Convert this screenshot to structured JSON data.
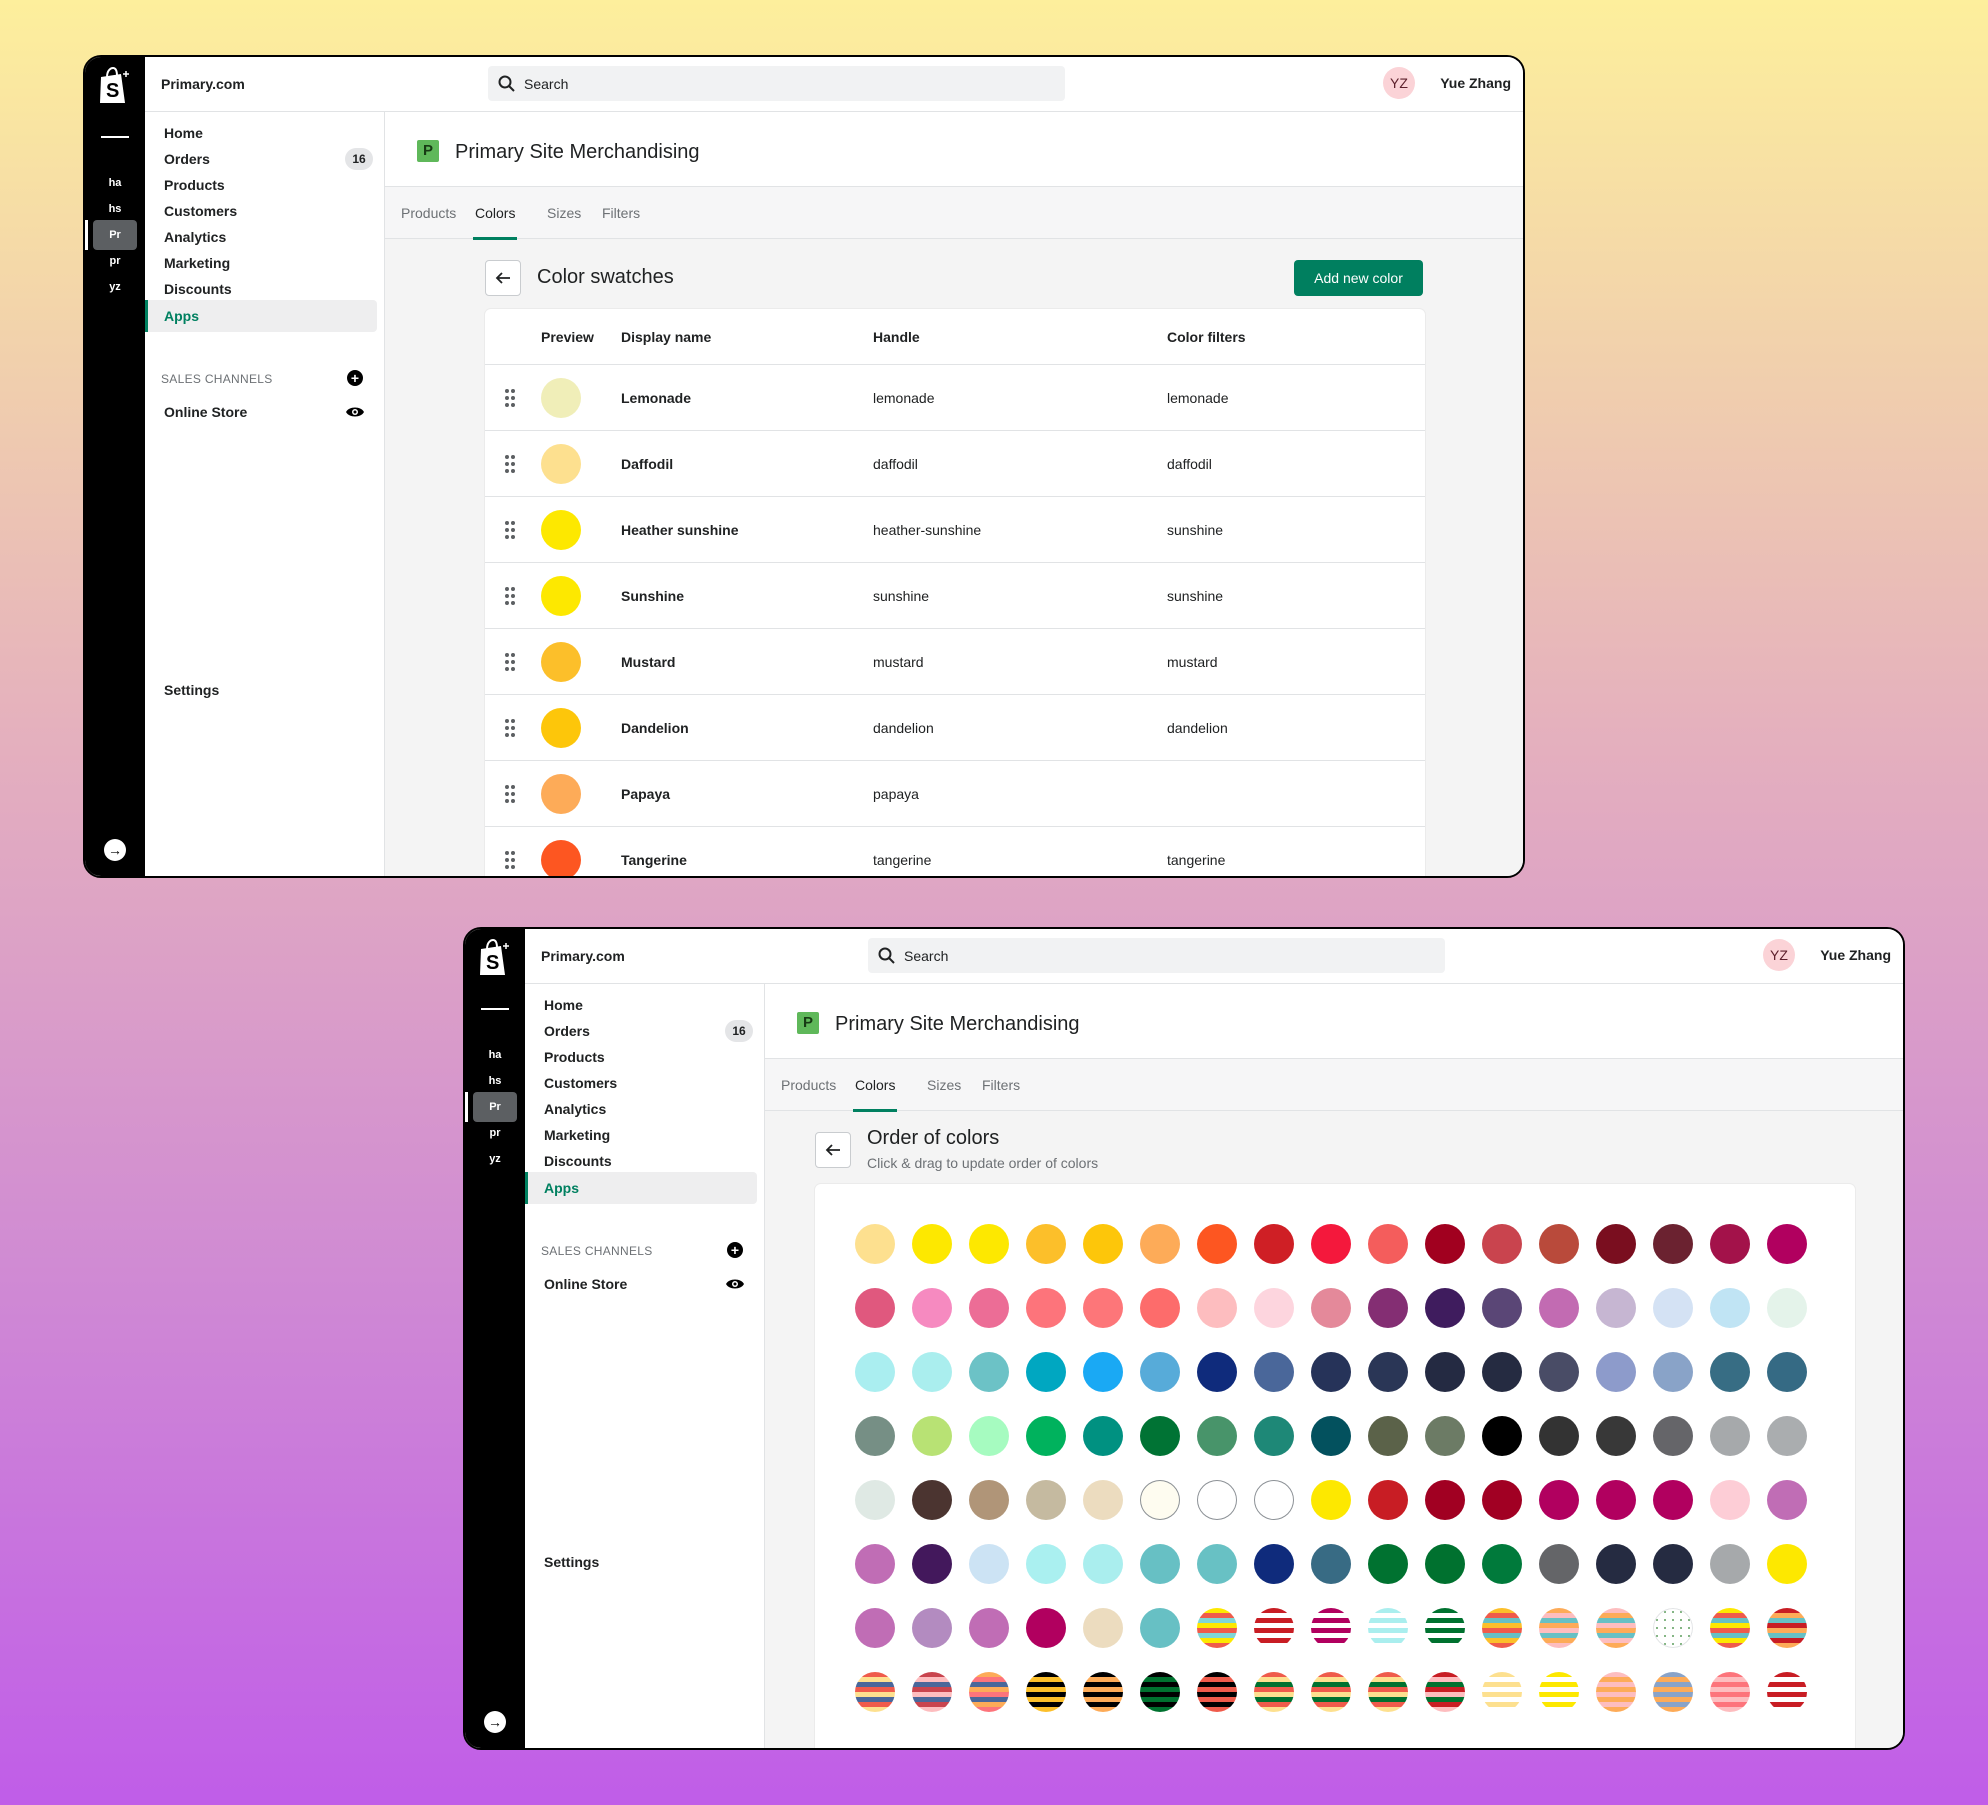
{
  "shared": {
    "store_name": "Primary.com",
    "search_placeholder": "Search",
    "user_initials": "YZ",
    "user_name": "Yue Zhang",
    "rail_stores": [
      "ha",
      "hs",
      "Pr",
      "pr",
      "yz"
    ],
    "nav": [
      {
        "label": "Home"
      },
      {
        "label": "Orders",
        "badge": "16"
      },
      {
        "label": "Products"
      },
      {
        "label": "Customers"
      },
      {
        "label": "Analytics"
      },
      {
        "label": "Marketing"
      },
      {
        "label": "Discounts"
      },
      {
        "label": "Apps",
        "active": true
      }
    ],
    "sales_channels_heading": "SALES CHANNELS",
    "online_store": "Online Store",
    "settings": "Settings",
    "app_icon_letter": "P",
    "page_title": "Primary Site Merchandising",
    "tabs": [
      "Products",
      "Colors",
      "Sizes",
      "Filters"
    ],
    "active_tab": "Colors",
    "accent_color": "#008060"
  },
  "window1": {
    "section_title": "Color swatches",
    "add_button": "Add new color",
    "columns": [
      "Preview",
      "Display name",
      "Handle",
      "Color filters"
    ],
    "rows": [
      {
        "name": "Lemonade",
        "handle": "lemonade",
        "filter": "lemonade",
        "color": "#f0eeb8"
      },
      {
        "name": "Daffodil",
        "handle": "daffodil",
        "filter": "daffodil",
        "color": "#fde08f"
      },
      {
        "name": "Heather sunshine",
        "handle": "heather-sunshine",
        "filter": "sunshine",
        "color": "#fde800"
      },
      {
        "name": "Sunshine",
        "handle": "sunshine",
        "filter": "sunshine",
        "color": "#fde800"
      },
      {
        "name": "Mustard",
        "handle": "mustard",
        "filter": "mustard",
        "color": "#fcbf2a"
      },
      {
        "name": "Dandelion",
        "handle": "dandelion",
        "filter": "dandelion",
        "color": "#fdc60a"
      },
      {
        "name": "Papaya",
        "handle": "papaya",
        "filter": "",
        "color": "#fdab58"
      },
      {
        "name": "Tangerine",
        "handle": "tangerine",
        "filter": "tangerine",
        "color": "#fd5621"
      }
    ]
  },
  "window2": {
    "section_title": "Order of colors",
    "section_subtitle": "Click & drag to update order of colors",
    "swatch_rows": [
      [
        "#fde08f",
        "#fde800",
        "#fde800",
        "#fcbf2a",
        "#fdc60a",
        "#fdab58",
        "#fd5621",
        "#cf1f25",
        "#f4183c",
        "#f45d5c",
        "#a1001f",
        "#c9444e",
        "#b94a3b",
        "#7a0e1f",
        "#6b2230",
        "#a3124a",
        "#b1005f"
      ],
      [
        "#e0587e",
        "#f68ac0",
        "#ec6d96",
        "#fd747b",
        "#fd7679",
        "#fd6c6b",
        "#fdbdbf",
        "#fdd5de",
        "#e4899a",
        "#842e73",
        "#3f1c5e",
        "#5a4676",
        "#c26bb2",
        "#c6b6d2",
        "#d4e2f4",
        "#c0e4f4",
        "#e4f3ea"
      ],
      [
        "#aaeef0",
        "#aaeeee",
        "#6cc2c6",
        "#00a7c1",
        "#1aa9f4",
        "#57abd9",
        "#0f2b7c",
        "#4a679a",
        "#263359",
        "#2a3656",
        "#242a42",
        "#252b41",
        "#494c66",
        "#8d9bcb",
        "#89a3c8",
        "#376d84",
        "#356a84"
      ],
      [
        "#768f85",
        "#b8e274",
        "#a6fbc0",
        "#00b25d",
        "#009181",
        "#007334",
        "#48946a",
        "#1e8877",
        "#03515e",
        "#5b6249",
        "#6c7b65",
        "#000000",
        "#333333",
        "#383838",
        "#656569",
        "#a6a9ab",
        "#aaadaf"
      ],
      [
        "#dfe9e4",
        "#4b3430",
        "#b09578",
        "#c5baa0",
        "#ecdcbf",
        "#fefcf0",
        "#ffffff",
        "#ffffff",
        "#fde800",
        "#c81d24",
        "#a10022",
        "#a10023",
        "#b1005f",
        "#b1005f",
        "#b1005f",
        "#fdcdd6",
        "#c06db5"
      ],
      [
        "#c06db5",
        "#43185c",
        "#cce3f4",
        "#aaf0f0",
        "#aaeeee",
        "#67c0c4",
        "#68c1c4",
        "#0f2b7c",
        "#386b84",
        "#007230",
        "#00712f",
        "#007a3b",
        "#646568",
        "#252b41",
        "#252b41",
        "#a6a9ab",
        "#fde800"
      ],
      [
        "#c06db5",
        "#b38bc0",
        "#c06db5",
        "#b1005f",
        "#ecdcbf",
        "#67c0c4",
        "s:#fde800|#ef5b4b|#7fd6d6",
        "s:#c81d24|#ffffff",
        "s:#b1005f|#ffffff",
        "s:#aaeeee|#ffffff",
        "s:#00712f|#ffffff",
        "s:#fcbf2a|#ef5b4b|#67c0c4",
        "s:#fdab58|#fdbdbf|#67c0c4",
        "s:#fdbdbf|#fdab58|#67c0c4",
        "d:#7fb27f",
        "s:#fde800|#ef5b4b|#67c0c4",
        "s:#c81d24|#fdab58|#67c0c4"
      ],
      [
        "s:#ef5b4b|#fde08f|#4a679a",
        "s:#c9444e|#fdbdbf|#4a679a",
        "s:#fdab58|#fd747b|#4a679a",
        "s:#000000|#fcbf2a",
        "s:#000000|#fdab58",
        "s:#000000|#00712f",
        "s:#000000|#ef5b4b",
        "s:#ef5b4b|#fde08f|#00712f",
        "s:#ef5b4b|#fde08f|#00712f",
        "s:#ef5b4b|#fde08f|#00712f",
        "s:#c81d24|#fdbdbf|#00712f",
        "s:#fde08f|#ffffff",
        "s:#fde800|#ffffff",
        "s:#fdbdbf|#fdab58",
        "s:#89a3c8|#fdab58",
        "s:#fd747b|#fdbdbf",
        "s:#c81d24|#ffffff"
      ]
    ]
  }
}
